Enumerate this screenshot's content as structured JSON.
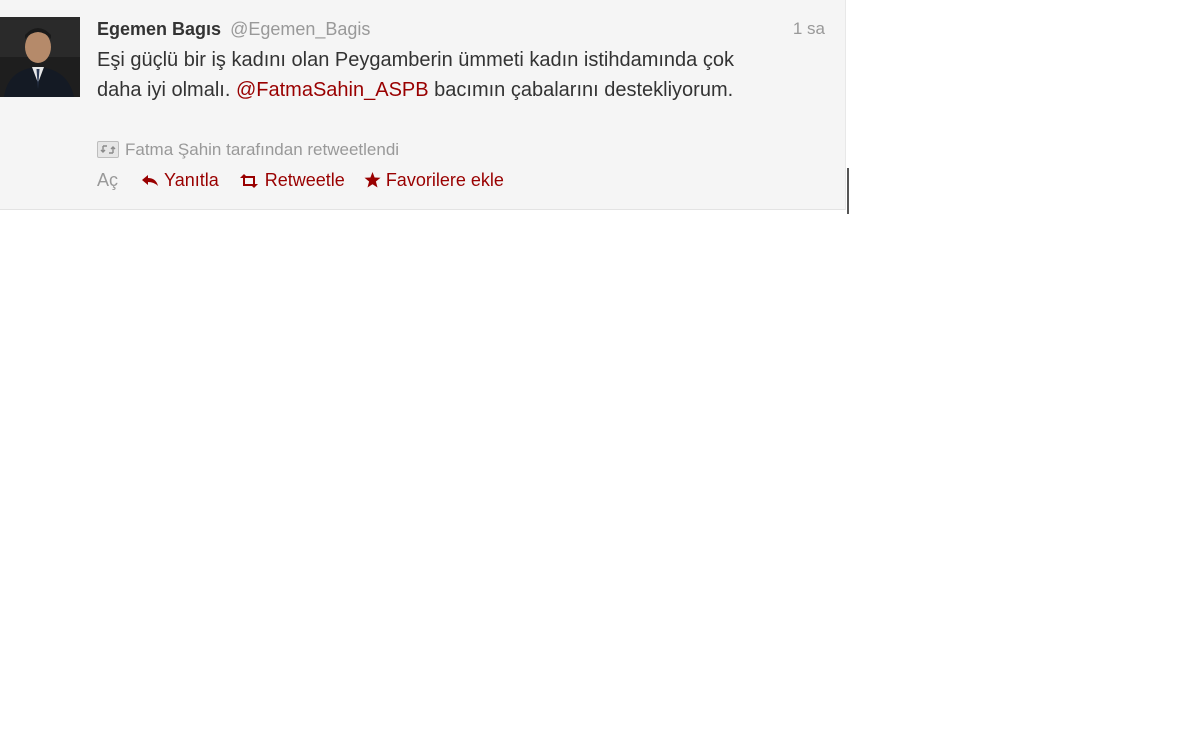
{
  "tweet": {
    "fullname": "Egemen Bagıs",
    "username": "@Egemen_Bagis",
    "time": "1 sa",
    "text_before": "Eşi güçlü bir iş kadını olan Peygamberin ümmeti kadın istihdamında çok daha iyi olmalı. ",
    "mention": "@FatmaSahin_ASPB",
    "text_after": " bacımın çabalarını destekliyorum.",
    "retweet_context": "Fatma Şahin tarafından retweetlendi",
    "actions": {
      "open": "Aç",
      "reply": "Yanıtla",
      "retweet": "Retweetle",
      "favorite": "Favorilere ekle"
    }
  },
  "icons": {
    "reply": "reply-arrow-icon",
    "retweet": "retweet-arrows-icon",
    "favorite": "star-icon",
    "retweeted": "retweet-badge-icon"
  },
  "colors": {
    "link": "#990000",
    "muted": "#999999",
    "text": "#333333",
    "background": "#f5f5f5"
  }
}
